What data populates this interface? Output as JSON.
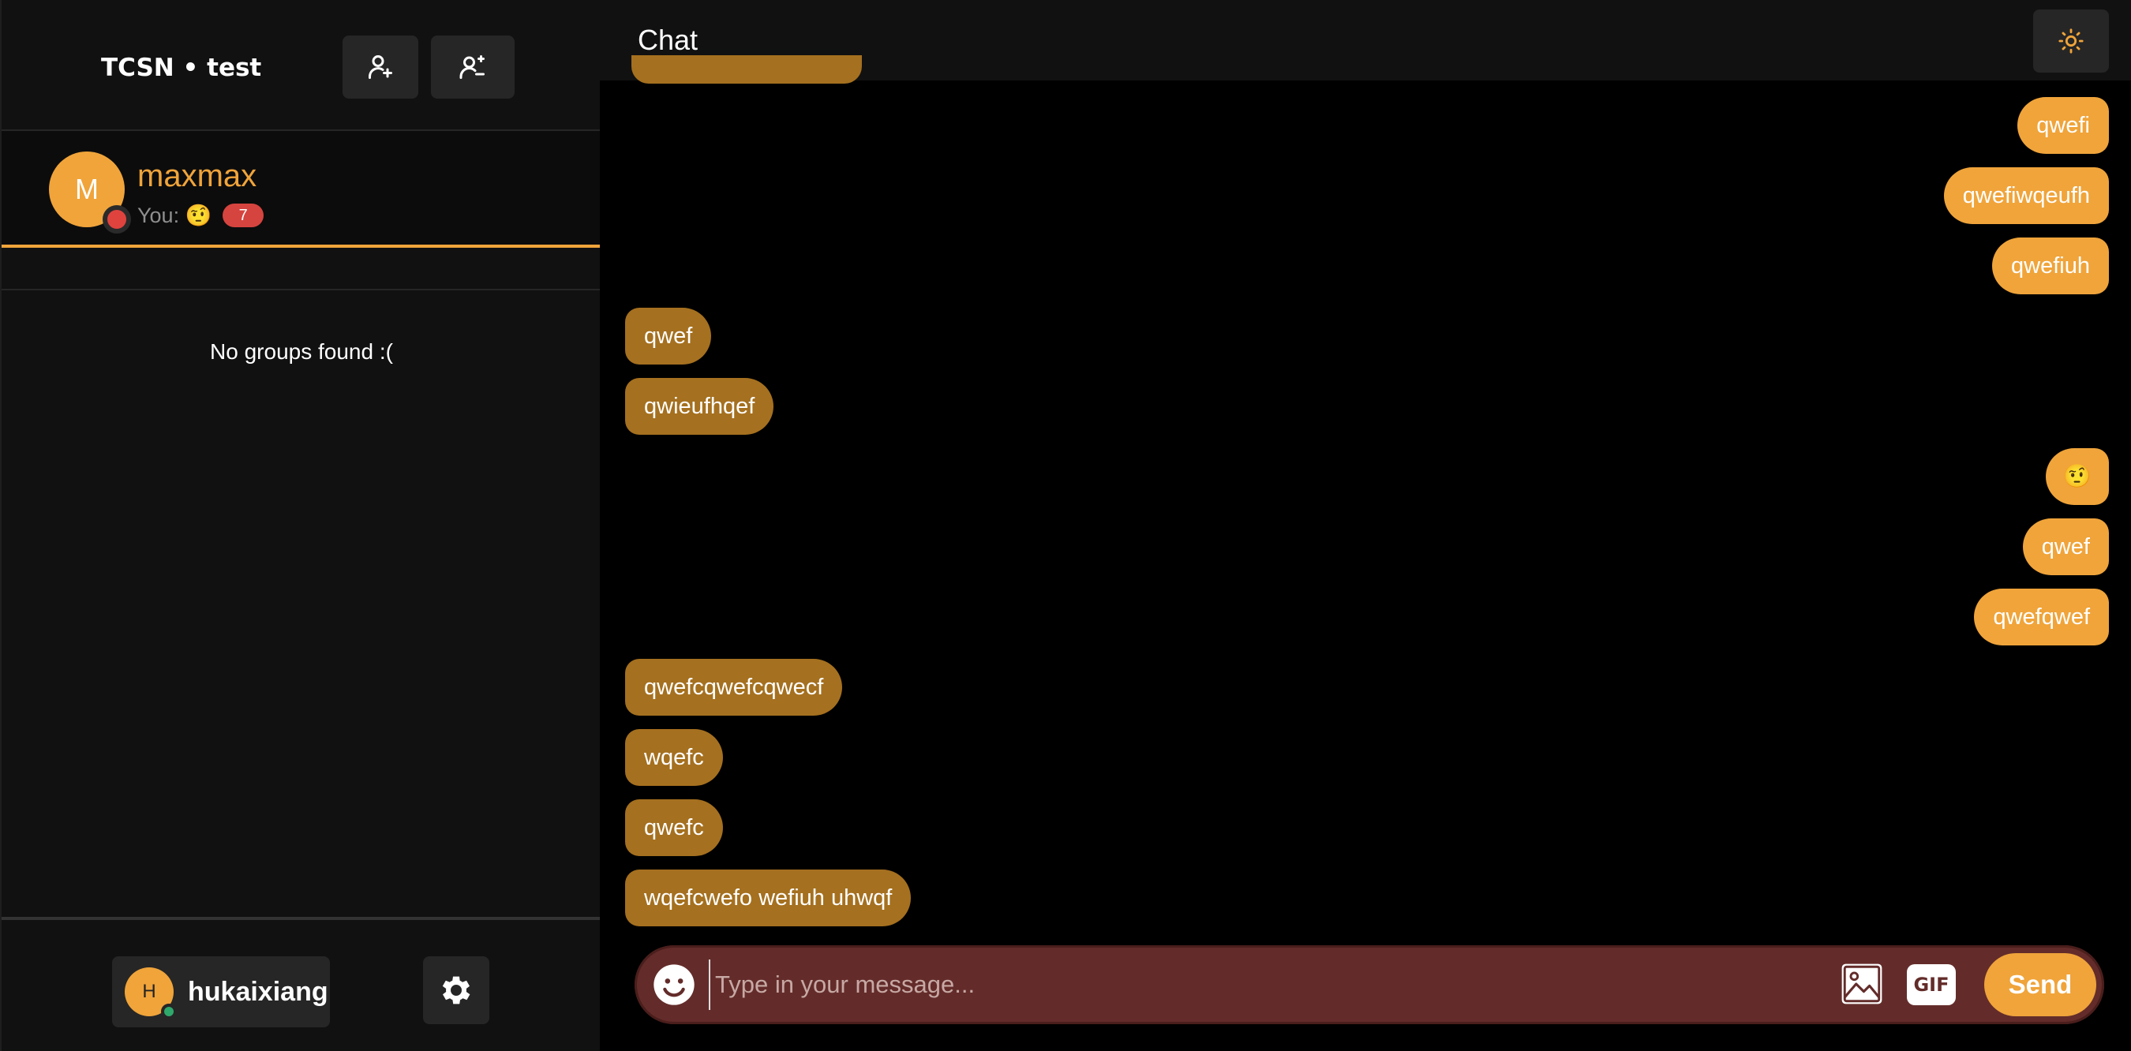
{
  "sidebar": {
    "brand": "TCSN • test",
    "header_buttons": [
      {
        "icon": "add-friend-icon"
      },
      {
        "icon": "create-group-icon"
      }
    ],
    "contact": {
      "avatar_letter": "M",
      "name": "maxmax",
      "last_message": "You: 🤨",
      "unread_count": "7",
      "status": "offline",
      "status_color": "#e0433e"
    },
    "empty_groups_text": "No groups found :(",
    "footer": {
      "avatar_letter": "H",
      "username": "hukaixiang",
      "status_color": "#2fa86b",
      "settings_icon": "gear-icon"
    }
  },
  "chat": {
    "title": "Chat",
    "theme_icon": "sun-icon",
    "messages": [
      {
        "side": "out",
        "text": "qwefi"
      },
      {
        "side": "out",
        "text": "qwefiwqeufh"
      },
      {
        "side": "out",
        "text": "qwefiuh"
      },
      {
        "side": "in",
        "text": "qwef"
      },
      {
        "side": "in",
        "text": "qwieufhqef"
      },
      {
        "side": "out",
        "text": "🤨"
      },
      {
        "side": "out",
        "text": "qwef"
      },
      {
        "side": "out",
        "text": "qwefqwef"
      },
      {
        "side": "in",
        "text": "qwefcqwefcqwecf"
      },
      {
        "side": "in",
        "text": "wqefc"
      },
      {
        "side": "in",
        "text": "qwefc"
      },
      {
        "side": "in",
        "text": "wqefcwefo wefiuh uhwqf"
      }
    ],
    "composer": {
      "placeholder": "Type in your message...",
      "value": "",
      "gif_label": "GIF",
      "send_label": "Send",
      "emoji_icon": "smiley-icon",
      "image_icon": "image-icon"
    }
  },
  "colors": {
    "accent": "#f0a43a",
    "incoming_bubble": "#a5701f",
    "outgoing_bubble": "#f0a43a",
    "composer_bg": "#632c2a",
    "badge": "#d6443f"
  }
}
